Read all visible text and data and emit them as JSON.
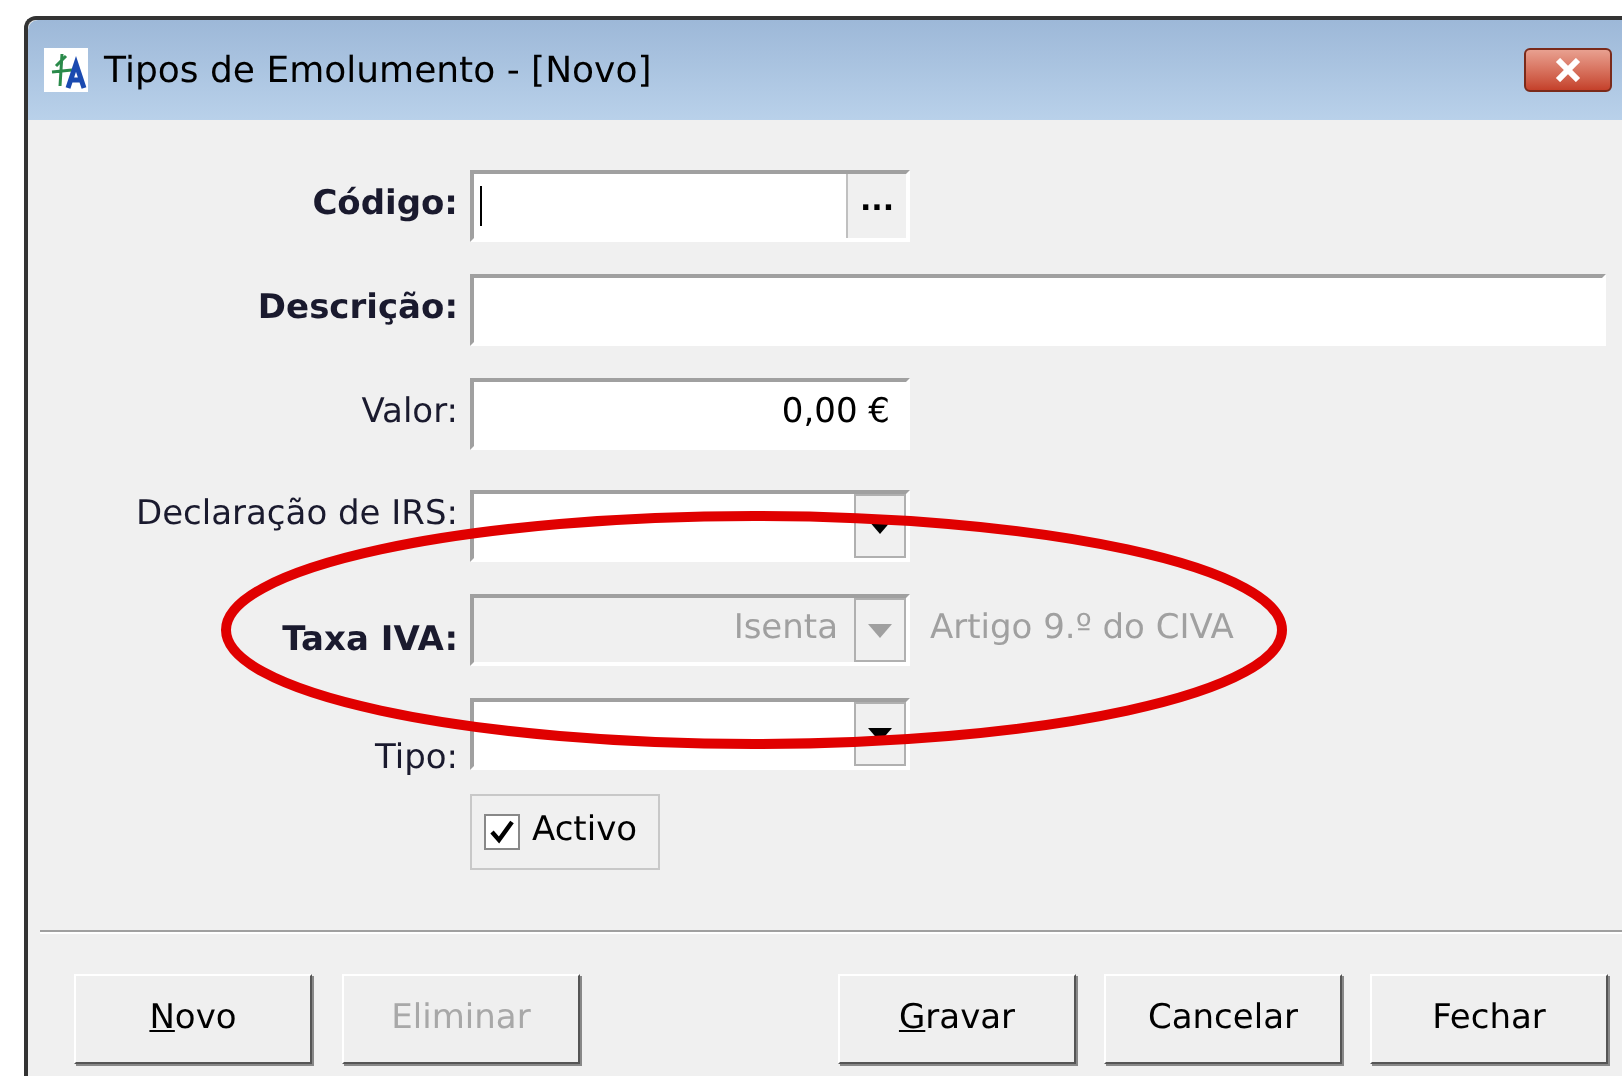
{
  "window": {
    "title": "Tipos de Emolumento - [Novo]"
  },
  "fields": [
    {
      "kind": "lookup",
      "label": "Código:",
      "bold": true,
      "disabled": false,
      "button": "..."
    },
    {
      "kind": "text",
      "label": "Descrição:",
      "bold": true,
      "disabled": false
    },
    {
      "kind": "money",
      "label": "Valor:",
      "bold": false,
      "value": "0,00 €",
      "disabled": false
    },
    {
      "kind": "combo",
      "label": "Declaração de IRS:",
      "bold": false,
      "disabled": false
    },
    {
      "kind": "combo",
      "label": "Taxa IVA:",
      "bold": true,
      "value": "Isenta",
      "disabled": true,
      "note": "Artigo 9.º do CIVA"
    },
    {
      "kind": "combo",
      "label": "Tipo:",
      "bold": false,
      "disabled": false
    }
  ],
  "checkbox": {
    "label": "Activo",
    "checked": true
  },
  "left_buttons": [
    {
      "label": "Novo",
      "accel": true,
      "disabled": false
    },
    {
      "label": "Eliminar",
      "accel": false,
      "disabled": true
    }
  ],
  "right_buttons": [
    {
      "label": "Gravar",
      "accel": true,
      "disabled": false
    },
    {
      "label": "Cancelar",
      "accel": false,
      "disabled": false
    },
    {
      "label": "Fechar",
      "accel": false,
      "disabled": false
    }
  ]
}
